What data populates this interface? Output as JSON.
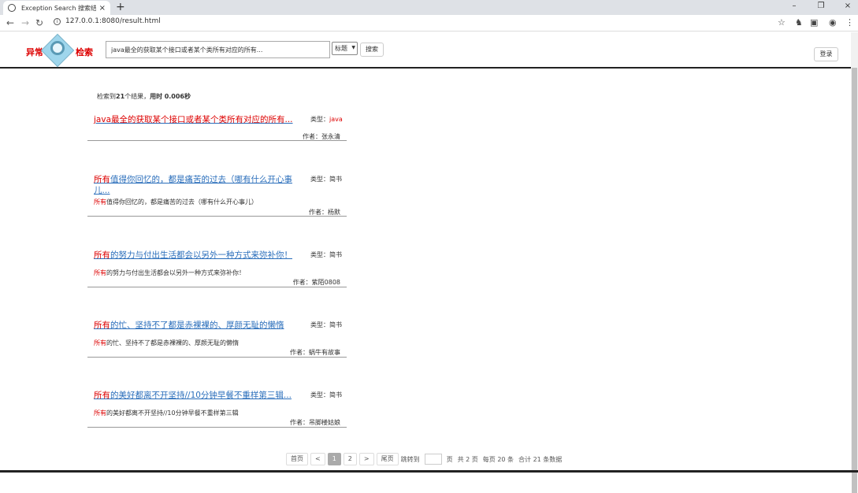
{
  "browser": {
    "tab_title": "Exception Search 搜索结果",
    "tab_close": "×",
    "new_tab": "+",
    "url": "127.0.0.1:8080/result.html",
    "win_min": "–",
    "win_restore": "❐",
    "win_close": "×"
  },
  "header": {
    "logo_left": "异常",
    "logo_right": "检索",
    "search_value": "java最全的获取某个接口或者某个类所有对应的所有...",
    "select_value": "标题",
    "search_button": "搜索",
    "login_button": "登录"
  },
  "summary": {
    "prefix": "检索到",
    "count": "21",
    "mid": "个结果，",
    "time_label": "用时",
    "time_value": "0.006秒"
  },
  "results": [
    {
      "title_hl": "java最全",
      "title_rest": "的获取某个接口或者某个类所有对应的所有...",
      "type_label": "类型：",
      "type": "java",
      "snippet_hl": "",
      "snippet_rest": "",
      "author": "作者：张永清"
    },
    {
      "title_hl": "所有",
      "title_rest": "值得你回忆的，都是痛苦的过去（哪有什么开心事儿...",
      "type_label": "类型：",
      "type": "简书",
      "snippet_hl": "所有",
      "snippet_rest": "值得你回忆的，都是痛苦的过去（哪有什么开心事儿）",
      "author": "作者：杨默"
    },
    {
      "title_hl": "所有",
      "title_rest": "的努力与付出生活都会以另外一种方式来弥补你！",
      "type_label": "类型：",
      "type": "简书",
      "snippet_hl": "所有",
      "snippet_rest": "的努力与付出生活都会以另外一种方式来弥补你！",
      "author": "作者：紫陌0808"
    },
    {
      "title_hl": "所有",
      "title_rest": "的忙、坚持不了都是赤裸裸的、厚颜无耻的懒惰",
      "type_label": "类型：",
      "type": "简书",
      "snippet_hl": "所有",
      "snippet_rest": "的忙、坚持不了都是赤裸裸的、厚颜无耻的懒惰",
      "author": "作者：蜗牛有故事"
    },
    {
      "title_hl": "所有",
      "title_rest": "的美好都离不开坚持//10分钟早餐不重样第三辑...",
      "type_label": "类型：",
      "type": "简书",
      "snippet_hl": "所有",
      "snippet_rest": "的美好都离不开坚持//10分钟早餐不重样第三辑",
      "author": "作者：吊脚楼姑娘"
    }
  ],
  "pager": {
    "first": "首页",
    "prev": "<",
    "page1": "1",
    "page2": "2",
    "next": ">",
    "last": "尾页",
    "jump_label": "跳转到",
    "page_unit": "页",
    "total_pages": "共 2 页",
    "per_page": "每页 20 条",
    "total_items": "合计 21 条数据"
  }
}
